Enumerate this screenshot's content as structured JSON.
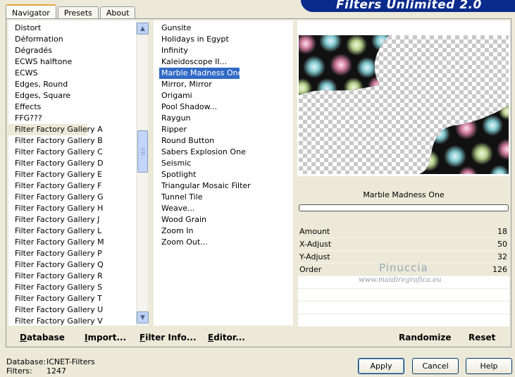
{
  "window": {
    "banner_title": "Filters Unlimited 2.0"
  },
  "tabs": [
    {
      "label": "Navigator",
      "active": true
    },
    {
      "label": "Presets",
      "active": false
    },
    {
      "label": "About",
      "active": false
    }
  ],
  "categories": {
    "items": [
      "Distort",
      "Déformation",
      "Dégradés",
      "ECWS halftone",
      "ECWS",
      "Edges, Round",
      "Edges, Square",
      "Effects",
      "FFG???",
      "Filter Factory Gallery A",
      "Filter Factory Gallery B",
      "Filter Factory Gallery C",
      "Filter Factory Gallery D",
      "Filter Factory Gallery E",
      "Filter Factory Gallery F",
      "Filter Factory Gallery G",
      "Filter Factory Gallery H",
      "Filter Factory Gallery J",
      "Filter Factory Gallery L",
      "Filter Factory Gallery M",
      "Filter Factory Gallery P",
      "Filter Factory Gallery Q",
      "Filter Factory Gallery R",
      "Filter Factory Gallery S",
      "Filter Factory Gallery T",
      "Filter Factory Gallery U",
      "Filter Factory Gallery V"
    ],
    "selected": "Filter Factory Gallery A"
  },
  "filters": {
    "items": [
      "Gunsite",
      "Holidays in Egypt",
      "Infinity",
      "Kaleidoscope II...",
      "Marble Madness One...",
      "Mirror, Mirror",
      "Origami",
      "Pool Shadow...",
      "Raygun",
      "Ripper",
      "Round Button",
      "Sabers Explosion One",
      "Seismic",
      "Spotlight",
      "Triangular Mosaic Filter",
      "Tunnel Tile",
      "Weave...",
      "Wood Grain",
      "Zoom In",
      "Zoom Out..."
    ],
    "selected": "Marble Madness One..."
  },
  "preview": {
    "filter_name": "Marble Madness One"
  },
  "params": [
    {
      "label": "Amount",
      "value": "18"
    },
    {
      "label": "X-Adjust",
      "value": "50"
    },
    {
      "label": "Y-Adjust",
      "value": "32"
    },
    {
      "label": "Order",
      "value": "126"
    }
  ],
  "watermark": {
    "line1": "Pinuccia",
    "line2": "www.maidiregrafica.eu"
  },
  "toolbar": {
    "database": "Database",
    "import": "Import...",
    "filter_info": "Filter Info...",
    "editor": "Editor...",
    "randomize": "Randomize",
    "reset": "Reset"
  },
  "status": {
    "database_label": "Database:",
    "database_value": "ICNET-Filters",
    "filters_label": "Filters:",
    "filters_value": "1247"
  },
  "dialog": {
    "apply": "Apply",
    "cancel": "Cancel",
    "help": "Help"
  },
  "colors": {
    "banner": "#0a2a8c",
    "selection": "#316ac5",
    "active_tab_accent": "#e8a33d"
  }
}
